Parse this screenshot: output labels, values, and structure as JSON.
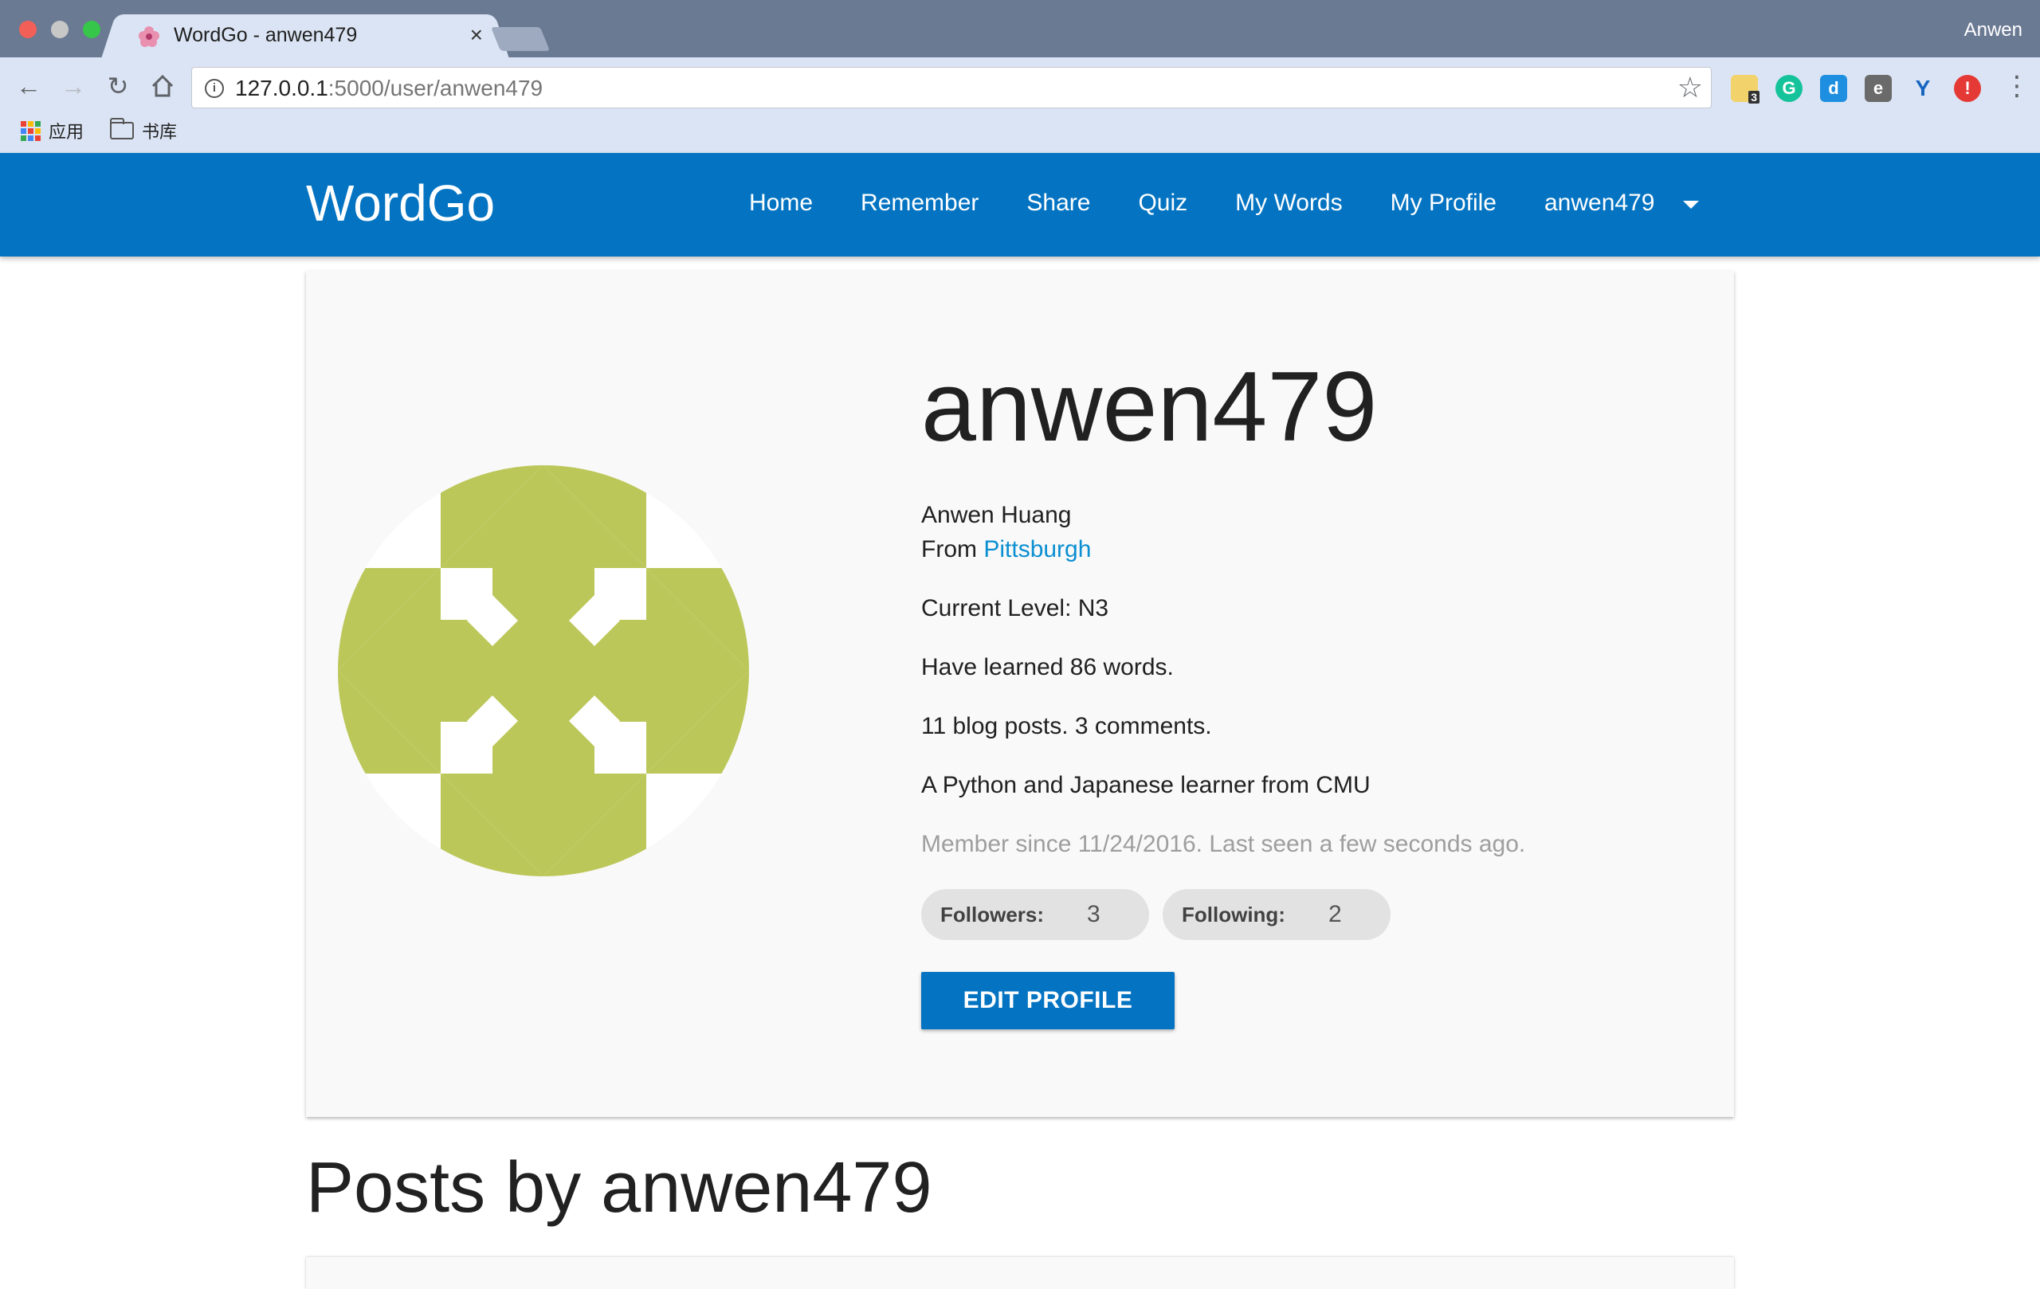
{
  "browser": {
    "tab_title": "WordGo - anwen479",
    "close_glyph": "×",
    "profile_name": "Anwen",
    "url_host": "127.0.0.1",
    "url_rest": ":5000/user/anwen479",
    "ext_badge": "3",
    "bookmarks": [
      "应用",
      "书库"
    ]
  },
  "navbar": {
    "brand": "WordGo",
    "links": [
      "Home",
      "Remember",
      "Share",
      "Quiz",
      "My Words",
      "My Profile",
      "anwen479"
    ]
  },
  "profile": {
    "username": "anwen479",
    "full_name": "Anwen Huang",
    "from_prefix": "From",
    "location": "Pittsburgh",
    "level": "Current Level: N3",
    "learned": "Have learned 86 words.",
    "activity": "11 blog posts. 3 comments.",
    "bio": "A Python and Japanese learner from CMU",
    "member_since": "Member since 11/24/2016. Last seen a few seconds ago.",
    "followers_label": "Followers:",
    "followers_count": "3",
    "following_label": "Following:",
    "following_count": "2",
    "edit_button": "EDIT PROFILE"
  },
  "posts_heading": "Posts by anwen479",
  "colors": {
    "navbar": "#0474c2",
    "avatar_fill": "#bcc75a",
    "link": "#0b8fd1"
  }
}
